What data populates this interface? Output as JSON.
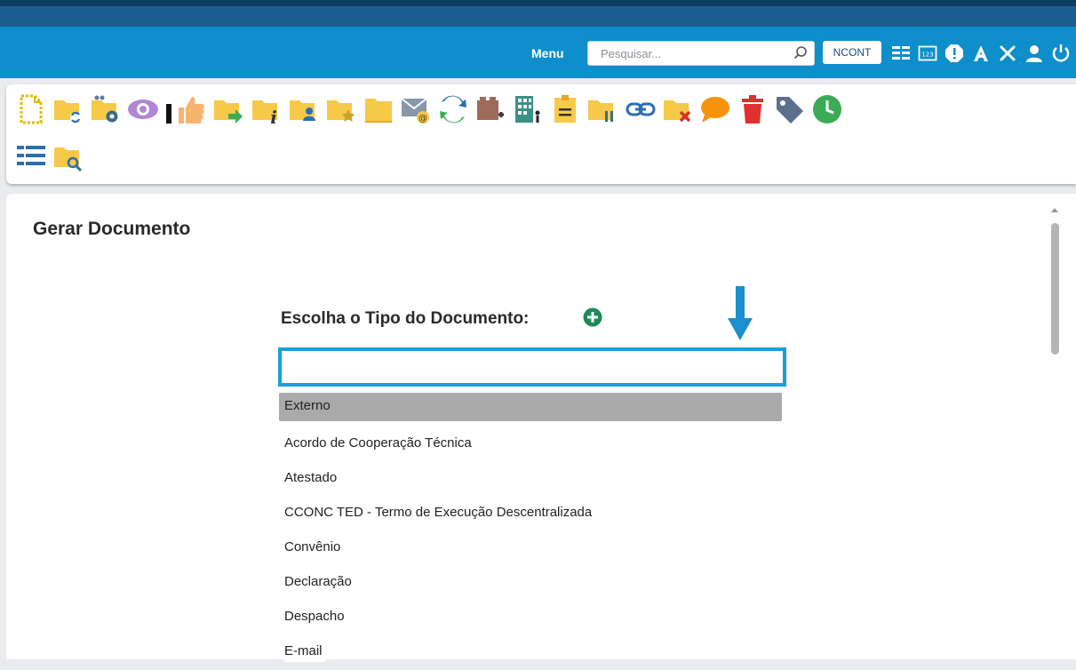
{
  "header": {
    "menu_label": "Menu",
    "search_placeholder": "Pesquisar...",
    "unit_label": "NCONT",
    "icons": [
      "list-view-icon",
      "numbered-icon",
      "alert-icon",
      "font-size-icon",
      "tools-icon",
      "user-icon",
      "power-icon"
    ]
  },
  "toolbar": {
    "row1": [
      "new-document-icon",
      "update-process-icon",
      "process-settings-icon",
      "view-icon",
      "separator",
      "approve-icon",
      "send-process-icon",
      "process-info-icon",
      "assign-process-icon",
      "follow-process-icon",
      "folder-icon",
      "send-email-icon",
      "relate-process-icon",
      "add-block-icon",
      "organization-icon",
      "note-icon",
      "pause-process-icon",
      "link-icon",
      "close-process-icon",
      "comment-icon",
      "delete-icon",
      "tag-icon",
      "clock-icon"
    ],
    "row2": [
      "tree-view-icon",
      "search-process-icon"
    ]
  },
  "main": {
    "title": "Gerar Documento",
    "subtitle": "Escolha o Tipo do Documento:",
    "filter_value": "",
    "document_types": [
      "Externo",
      "Acordo de Cooperação Técnica",
      "Atestado",
      "CCONC TED - Termo de Execução Descentralizada",
      "Convênio",
      "Declaração",
      "Despacho",
      "E-mail"
    ],
    "selected_index": 0
  },
  "colors": {
    "header_dark": "#1c5e8f",
    "header_blue": "#0e8ecb",
    "folder_yellow": "#f7c948",
    "highlight_blue": "#1b9fd5",
    "selected_gray": "#aaaaaa",
    "add_green": "#1e8a5a"
  }
}
